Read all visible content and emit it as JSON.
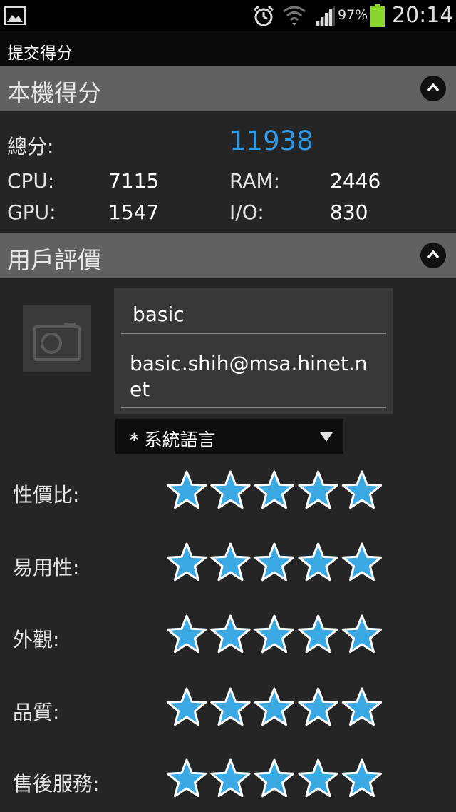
{
  "statusbar": {
    "battery_percent": "97%",
    "time": "20:14",
    "icons": [
      "gallery-icon",
      "alarm-icon",
      "wifi-icon",
      "signal-icon",
      "battery-icon"
    ]
  },
  "titlebar": {
    "title": "提交得分"
  },
  "device_score": {
    "header": "本機得分",
    "total_label": "總分:",
    "total_value": "11938",
    "cpu_label": "CPU:",
    "cpu_value": "7115",
    "ram_label": "RAM:",
    "ram_value": "2446",
    "gpu_label": "GPU:",
    "gpu_value": "1547",
    "io_label": "I/O:",
    "io_value": "830"
  },
  "user_review": {
    "header": "用戶評價",
    "name_value": "basic",
    "email_value": "basic.shih@msa.hinet.net",
    "language_selected": "* 系統語言",
    "ratings": [
      {
        "label": "性價比:",
        "stars": 5,
        "max": 5
      },
      {
        "label": "易用性:",
        "stars": 5,
        "max": 5
      },
      {
        "label": "外觀:",
        "stars": 5,
        "max": 5
      },
      {
        "label": "品質:",
        "stars": 5,
        "max": 5
      },
      {
        "label": "售後服務:",
        "stars": 5,
        "max": 5
      }
    ]
  },
  "colors": {
    "accent_blue": "#2e9bea",
    "star_fill": "#3aa9e4",
    "star_outline": "#ffffff",
    "header_bg": "#616161",
    "background": "#252525"
  }
}
